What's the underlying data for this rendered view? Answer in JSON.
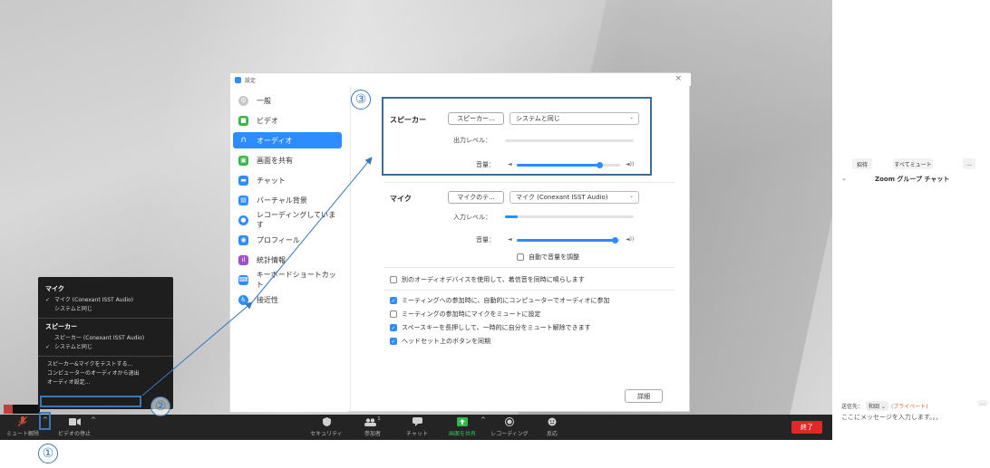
{
  "dialog": {
    "title": "設定",
    "close": "×",
    "sidebar": [
      {
        "label": "一般",
        "color": "#c7c7c7",
        "active": false
      },
      {
        "label": "ビデオ",
        "color": "#39b54a",
        "active": false
      },
      {
        "label": "オーディオ",
        "color": "#2d8cff",
        "active": true
      },
      {
        "label": "画面を共有",
        "color": "#39b54a",
        "active": false
      },
      {
        "label": "チャット",
        "color": "#2d8cff",
        "active": false
      },
      {
        "label": "バーチャル背景",
        "color": "#2d8cff",
        "active": false
      },
      {
        "label": "レコーディングしています",
        "color": "#2d8cff",
        "active": false
      },
      {
        "label": "プロフィール",
        "color": "#2d8cff",
        "active": false
      },
      {
        "label": "統計情報",
        "color": "#a050c8",
        "active": false
      },
      {
        "label": "キーボードショートカット",
        "color": "#2d8cff",
        "active": false
      },
      {
        "label": "接近性",
        "color": "#2d8cff",
        "active": false
      }
    ],
    "speaker": {
      "label": "スピーカー",
      "test_button": "スピーカー...",
      "device": "システムと同じ",
      "output_level_label": "出力レベル：",
      "volume_label": "音量：",
      "volume_level": 0.8
    },
    "mic": {
      "label": "マイク",
      "test_button": "マイクのテ...",
      "device": "マイク (Conexant ISST Audio)",
      "input_level_label": "入力レベル：",
      "input_level": 0.1,
      "volume_label": "音量：",
      "volume_level": 0.95,
      "auto_adjust": "自動で音量を調整"
    },
    "options": [
      {
        "label": "別のオーディオデバイスを使用して、着信音を同時に鳴らします",
        "checked": false
      },
      {
        "label": "ミーティングへの参加時に、自動的にコンピューターでオーディオに参加",
        "checked": true
      },
      {
        "label": "ミーティングの参加時にマイクをミュートに設定",
        "checked": false
      },
      {
        "label": "スペースキーを長押しして、一時的に自分をミュート解除できます",
        "checked": true
      },
      {
        "label": "ヘッドセット上のボタンを同期",
        "checked": true
      }
    ],
    "advanced_button": "詳細"
  },
  "audio_menu": {
    "mic_header": "マイク",
    "mic_items": [
      {
        "label": "マイク (Conexant ISST Audio)",
        "checked": true
      },
      {
        "label": "システムと同じ",
        "checked": false
      }
    ],
    "speaker_header": "スピーカー",
    "speaker_items": [
      {
        "label": "スピーカー (Conexant ISST Audio)",
        "checked": false
      },
      {
        "label": "システムと同じ",
        "checked": true
      }
    ],
    "actions": [
      "スピーカー&マイクをテストする...",
      "コンピューターのオーディオから退出",
      "オーディオ設定..."
    ]
  },
  "toolbar": {
    "mute": "ミュート解除",
    "video": "ビデオの停止",
    "security": "セキュリティ",
    "participants": "参加者",
    "participants_count": "1",
    "chat": "チャット",
    "share": "画面を共有",
    "record": "レコーディング",
    "reactions": "反応",
    "end": "終了"
  },
  "annotations": {
    "n1": "①",
    "n2": "②",
    "n3": "③",
    "color": "#3a77b8"
  },
  "chat": {
    "invite": "招待",
    "mute_all": "すべてミュート",
    "more": "...",
    "title": "Zoom グループ チャット",
    "send_to_label": "送信先：",
    "send_to_value": "和田 ⌄",
    "privacy": "(プライベート)",
    "input_placeholder": "ここにメッセージを入力します。。。"
  }
}
